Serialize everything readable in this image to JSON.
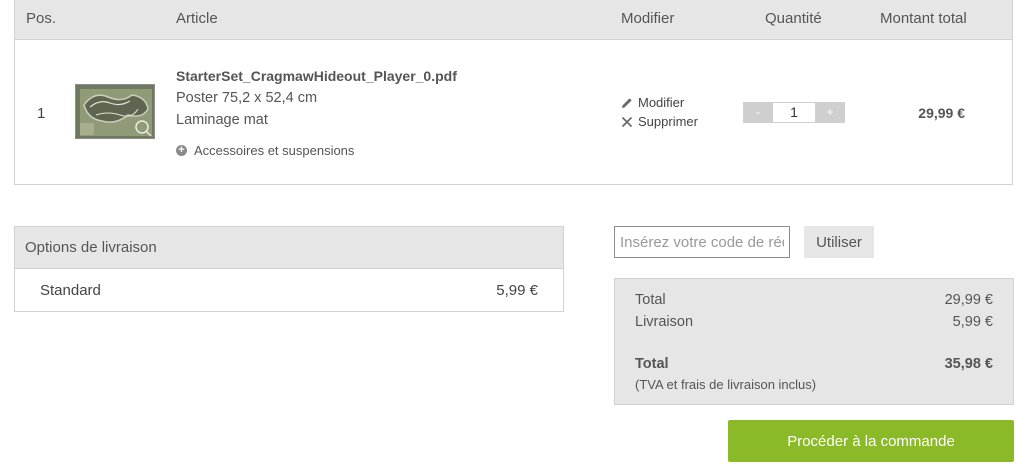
{
  "cart": {
    "headers": {
      "pos": "Pos.",
      "article": "Article",
      "modifier": "Modifier",
      "quantity": "Quantité",
      "total": "Montant total"
    },
    "items": [
      {
        "pos": "1",
        "filename": "StarterSet_CragmawHideout_Player_0.pdf",
        "format": "Poster 75,2 x 52,4 cm",
        "finish": "Laminage mat",
        "accessories": "Accessoires et suspensions",
        "edit_label": "Modifier",
        "delete_label": "Supprimer",
        "quantity": "1",
        "minus_label": "-",
        "plus_label": "+",
        "total": "29,99 €",
        "thumbnail_icon": "map-thumbnail"
      }
    ]
  },
  "shipping": {
    "title": "Options de livraison",
    "option_name": "Standard",
    "option_price": "5,99 €"
  },
  "coupon": {
    "placeholder": "Insérez votre code de réduction",
    "button_label": "Utiliser"
  },
  "summary": {
    "subtotal_label": "Total",
    "subtotal_value": "29,99 €",
    "shipping_label": "Livraison",
    "shipping_value": "5,99 €",
    "total_label": "Total",
    "total_value": "35,98 €",
    "note": "(TVA et frais de livraison inclus)"
  },
  "checkout": {
    "button_label": "Procéder à la commande",
    "color": "#8bba29"
  }
}
